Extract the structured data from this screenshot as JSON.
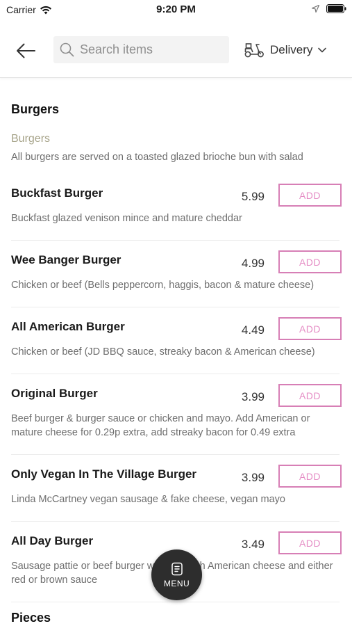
{
  "status_bar": {
    "carrier": "Carrier",
    "time": "9:20 PM"
  },
  "header": {
    "search_placeholder": "Search items",
    "delivery_label": "Delivery"
  },
  "menu": {
    "section_title": "Burgers",
    "subcategory": {
      "title": "Burgers",
      "description": "All burgers are served on a toasted glazed brioche bun with salad"
    },
    "items": [
      {
        "name": "Buckfast Burger",
        "price": "5.99",
        "description": "Buckfast glazed venison mince and mature cheddar"
      },
      {
        "name": "Wee Banger Burger",
        "price": "4.99",
        "description": "Chicken or beef (Bells peppercorn, haggis, bacon & mature cheese)"
      },
      {
        "name": "All American Burger",
        "price": "4.49",
        "description": "Chicken or beef (JD BBQ sauce, streaky bacon & American cheese)"
      },
      {
        "name": "Original Burger",
        "price": "3.99",
        "description": "Beef burger & burger sauce or chicken and mayo. Add American or mature cheese for 0.29p extra, add streaky bacon for 0.49 extra"
      },
      {
        "name": "Only Vegan In The Village Burger",
        "price": "3.99",
        "description": "Linda McCartney vegan sausage & fake cheese, vegan mayo"
      },
      {
        "name": "All Day Burger",
        "price": "3.49",
        "description": "Sausage pattie or beef burger with egg with American cheese and either red or brown sauce"
      }
    ],
    "add_label": "ADD",
    "next_section_title": "Pieces"
  },
  "fab": {
    "label": "MENU"
  },
  "colors": {
    "accent": "#d77fb6",
    "subcategory": "#a7a48a",
    "fab": "#2d2d2d"
  }
}
